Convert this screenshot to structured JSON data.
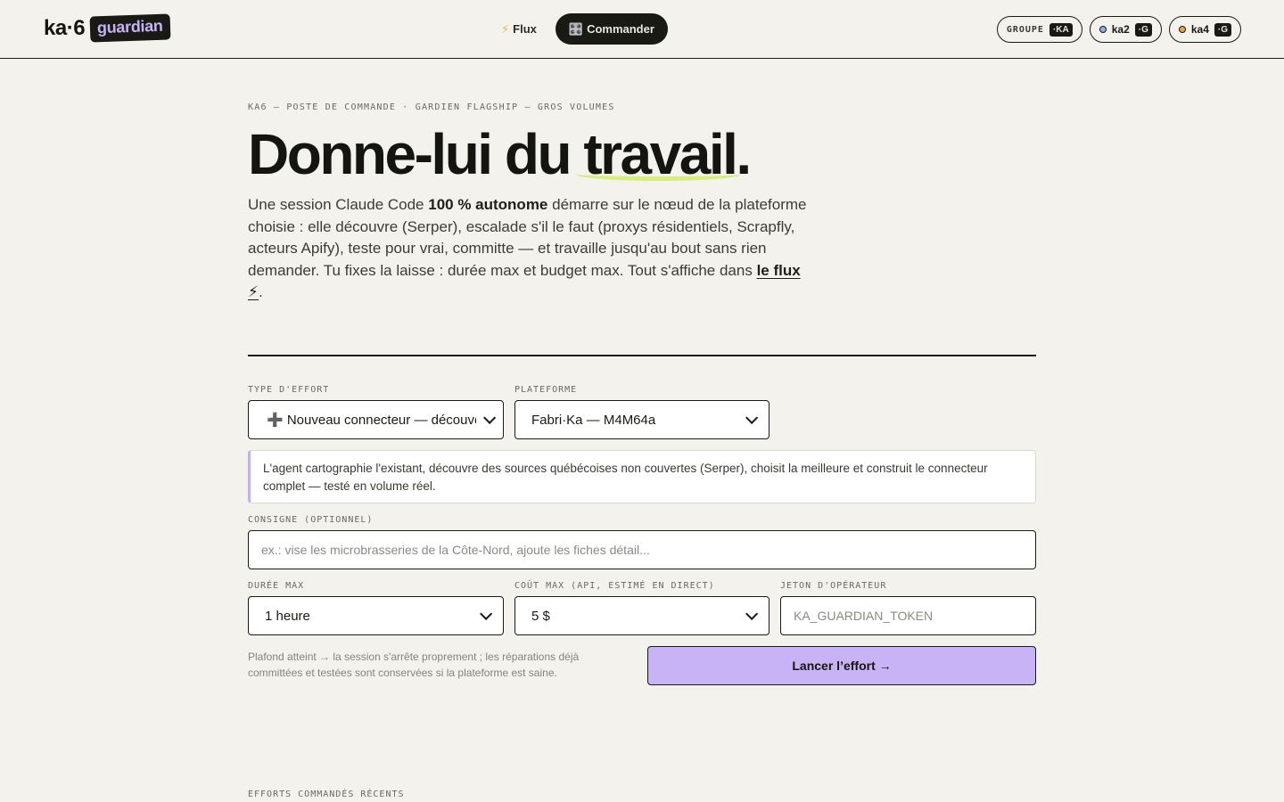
{
  "header": {
    "logo_word": "ka·6",
    "logo_badge": "guardian",
    "nav": [
      {
        "icon": "⚡",
        "label": "Flux"
      },
      {
        "icon": "🎛️",
        "label": "Commander"
      }
    ],
    "pills": [
      {
        "label": "GROUPE",
        "tag": "·KA"
      },
      {
        "label": "ka2",
        "tag": "·G",
        "dot_color": "#8ab0e8"
      },
      {
        "label": "ka4",
        "tag": "·G",
        "dot_color": "#e8a53b"
      }
    ]
  },
  "hero": {
    "eyebrow": "KA6 — POSTE DE COMMANDE · GARDIEN FLAGSHIP — GROS VOLUMES",
    "headline_start": "Donne-lui du ",
    "headline_highlight": "travail",
    "headline_end": ".",
    "intro_1": "Une session Claude Code ",
    "intro_bold": "100 % autonome",
    "intro_2": " démarre sur le nœud de la plateforme choisie : elle découvre (Serper), escalade s'il le faut (proxys résidentiels, Scrapfly, acteurs Apify), teste pour vrai, committe — et travaille jusqu'au bout sans rien demander. Tu fixes la laisse : durée max et budget max. Tout s'affiche dans ",
    "intro_link": "le flux ⚡",
    "intro_3": "."
  },
  "form": {
    "effort_label": "TYPE D'EFFORT",
    "effort_value": "➕ Nouveau connecteur — découverte",
    "platform_label": "PLATEFORME",
    "platform_value": "Fabri·Ka — M4M64a",
    "effort_note": "L'agent cartographie l'existant, découvre des sources québécoises non couvertes (Serper), choisit la meilleure et construit le connecteur complet — testé en volume réel.",
    "consigne_label": "CONSIGNE (OPTIONNEL)",
    "consigne_placeholder": "ex.: vise les microbrasseries de la Côte-Nord, ajoute les fiches détail...",
    "duree_label": "DURÉE MAX",
    "duree_value": "1 heure",
    "cout_label": "COÛT MAX (API, ESTIMÉ EN DIRECT)",
    "cout_value": "5 $",
    "jeton_label": "JETON D'OPÉRATEUR",
    "jeton_placeholder": "KA_GUARDIAN_TOKEN",
    "hint": "Plafond atteint → la session s'arrête proprement ; les réparations déjà committées et testées sont conservées si la plateforme est saine.",
    "launch_label": "Lancer l’effort →"
  },
  "recent": {
    "label": "EFFORTS COMMANDÉS RÉCENTS"
  }
}
